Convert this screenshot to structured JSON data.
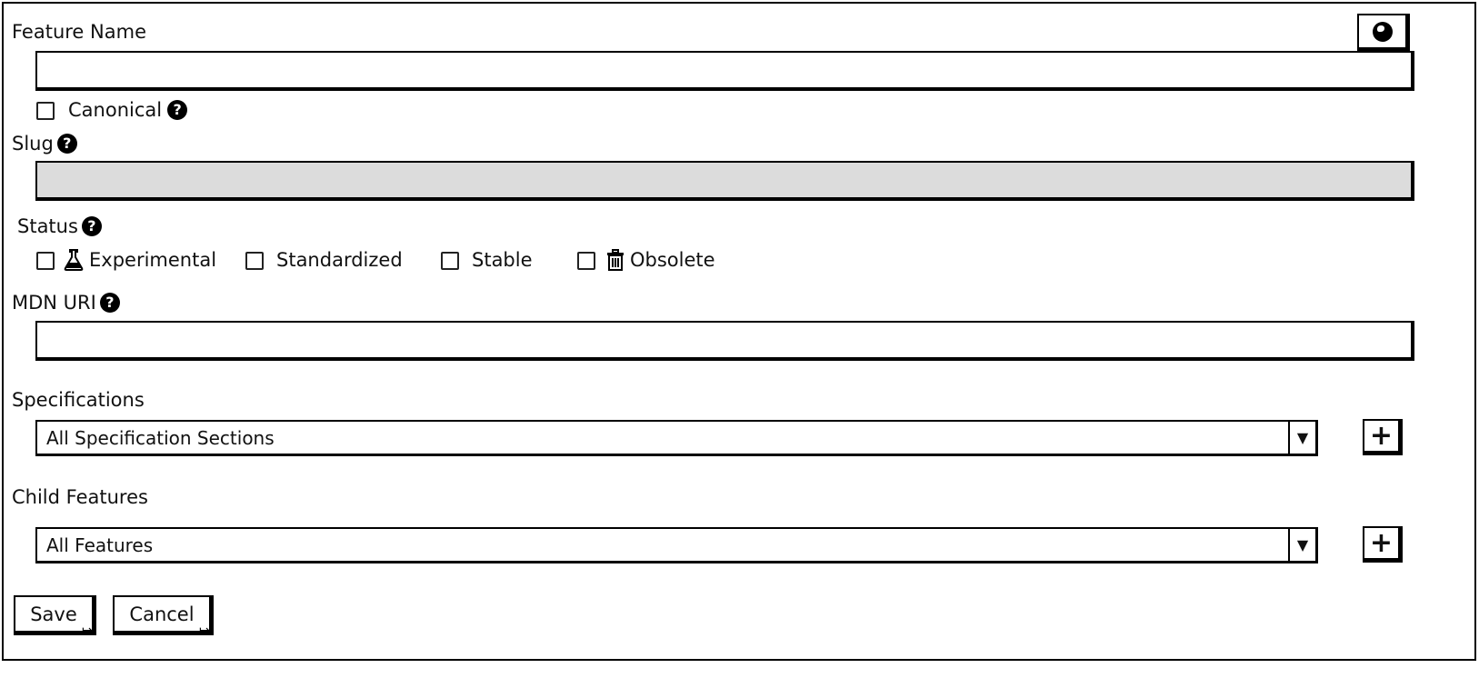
{
  "form": {
    "feature_name_label": "Feature Name",
    "feature_name_value": "",
    "canonical_label": "Canonical",
    "slug_label": "Slug",
    "slug_value": "",
    "status_label": "Status",
    "status_options": [
      {
        "label": "Experimental",
        "checked": false,
        "icon": "flask-icon"
      },
      {
        "label": "Standardized",
        "checked": false,
        "icon": ""
      },
      {
        "label": "Stable",
        "checked": false,
        "icon": ""
      },
      {
        "label": "Obsolete",
        "checked": false,
        "icon": "trash-icon"
      }
    ],
    "mdn_uri_label": "MDN URI",
    "mdn_uri_value": "",
    "specifications_label": "Specifications",
    "specifications_selected": "All Specification Sections",
    "child_features_label": "Child Features",
    "child_features_selected": "All Features",
    "help_glyph": "?",
    "add_glyph": "+",
    "dropdown_glyph": "▼"
  },
  "buttons": {
    "save": "Save",
    "cancel": "Cancel"
  },
  "icons": {
    "language": "globe-icon",
    "help": "help-icon",
    "add": "plus-icon",
    "dropdown": "chevron-down-icon",
    "link": "external-link-icon"
  }
}
